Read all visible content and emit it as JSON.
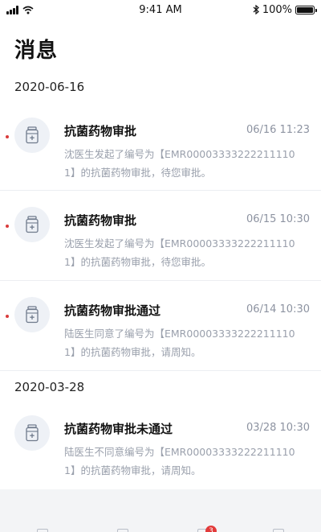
{
  "status_bar": {
    "time": "9:41 AM",
    "battery": "100%"
  },
  "page": {
    "title": "消息"
  },
  "groups": [
    {
      "date": "2020-06-16",
      "items": [
        {
          "title": "抗菌药物审批",
          "time": "06/16 11:23",
          "desc": "沈医生发起了编号为【EMR000033332222111101】的抗菌药物审批，待您审批。",
          "unread": true
        },
        {
          "title": "抗菌药物审批",
          "time": "06/15 10:30",
          "desc": "沈医生发起了编号为【EMR000033332222111101】的抗菌药物审批，待您审批。",
          "unread": true
        },
        {
          "title": "抗菌药物审批通过",
          "time": "06/14 10:30",
          "desc": "陆医生同意了编号为【EMR000033332222111101】的抗菌药物审批，请周知。",
          "unread": true
        }
      ]
    },
    {
      "date": "2020-03-28",
      "items": [
        {
          "title": "抗菌药物审批未通过",
          "time": "03/28 10:30",
          "desc": "陆医生不同意编号为【EMR000033332222111101】的抗菌药物审批，请周知。",
          "unread": false
        }
      ]
    }
  ],
  "tab_bar": {
    "badge_count": "3"
  },
  "icons": {
    "message_item": "medicine-bottle-icon"
  },
  "colors": {
    "unread_dot": "#d93c3c",
    "muted_text": "#9aa0ac",
    "avatar_bg": "#eef1f6"
  }
}
